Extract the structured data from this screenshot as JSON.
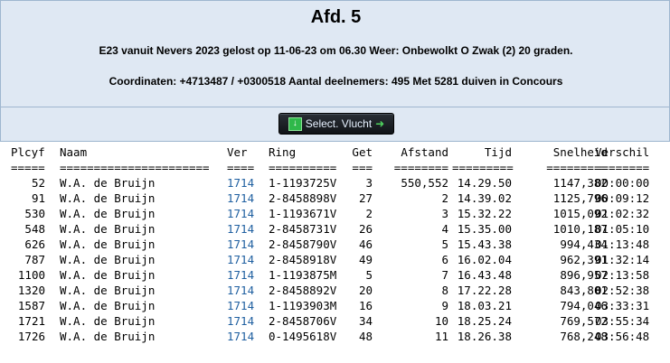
{
  "header": {
    "title": "Afd. 5",
    "line1": "E23 vanuit Nevers 2023 gelost op 11-06-23 om 06.30 Weer: Onbewolkt O Zwak (2) 20 graden.",
    "line2": "Coordinaten: +4713487 / +0300518 Aantal deelnemers: 495 Met 5281 duiven in Concours"
  },
  "toolbar": {
    "select_label": "Select. Vlucht"
  },
  "table": {
    "columns": {
      "plcyf": "Plcyf",
      "naam": "Naam",
      "ver": "Ver",
      "ring": "Ring",
      "get": "Get",
      "afstand": "Afstand",
      "tijd": "Tijd",
      "snelheid": "Snelheid",
      "verschil": "Verschil"
    },
    "separators": {
      "plcyf": "=====",
      "naam": "======================",
      "ver": "====",
      "ring": "==========",
      "get": "===",
      "afstand": "========",
      "tijd": "=========",
      "snelheid": "=========",
      "verschil": "========"
    },
    "rows": [
      {
        "plcyf": "52",
        "naam": "W.A. de Bruijn",
        "ver": "1714",
        "ring": "1-1193725V",
        "get": "3",
        "afstand": "550,552",
        "tijd": "14.29.50",
        "snelheid": "1147,382",
        "verschil": "00:00:00"
      },
      {
        "plcyf": "91",
        "naam": "W.A. de Bruijn",
        "ver": "1714",
        "ring": "2-8458898V",
        "get": "27",
        "afstand": "2",
        "tijd": "14.39.02",
        "snelheid": "1125,796",
        "verschil": "00:09:12"
      },
      {
        "plcyf": "530",
        "naam": "W.A. de Bruijn",
        "ver": "1714",
        "ring": "1-1193671V",
        "get": "2",
        "afstand": "3",
        "tijd": "15.32.22",
        "snelheid": "1015,092",
        "verschil": "01:02:32"
      },
      {
        "plcyf": "548",
        "naam": "W.A. de Bruijn",
        "ver": "1714",
        "ring": "2-8458731V",
        "get": "26",
        "afstand": "4",
        "tijd": "15.35.00",
        "snelheid": "1010,187",
        "verschil": "01:05:10"
      },
      {
        "plcyf": "626",
        "naam": "W.A. de Bruijn",
        "ver": "1714",
        "ring": "2-8458790V",
        "get": "46",
        "afstand": "5",
        "tijd": "15.43.38",
        "snelheid": "994,434",
        "verschil": "01:13:48"
      },
      {
        "plcyf": "787",
        "naam": "W.A. de Bruijn",
        "ver": "1714",
        "ring": "2-8458918V",
        "get": "49",
        "afstand": "6",
        "tijd": "16.02.04",
        "snelheid": "962,391",
        "verschil": "01:32:14"
      },
      {
        "plcyf": "1100",
        "naam": "W.A. de Bruijn",
        "ver": "1714",
        "ring": "1-1193875M",
        "get": "5",
        "afstand": "7",
        "tijd": "16.43.48",
        "snelheid": "896,957",
        "verschil": "02:13:58"
      },
      {
        "plcyf": "1320",
        "naam": "W.A. de Bruijn",
        "ver": "1714",
        "ring": "2-8458892V",
        "get": "20",
        "afstand": "8",
        "tijd": "17.22.28",
        "snelheid": "843,801",
        "verschil": "02:52:38"
      },
      {
        "plcyf": "1587",
        "naam": "W.A. de Bruijn",
        "ver": "1714",
        "ring": "1-1193903M",
        "get": "16",
        "afstand": "9",
        "tijd": "18.03.21",
        "snelheid": "794,046",
        "verschil": "03:33:31"
      },
      {
        "plcyf": "1721",
        "naam": "W.A. de Bruijn",
        "ver": "1714",
        "ring": "2-8458706V",
        "get": "34",
        "afstand": "10",
        "tijd": "18.25.24",
        "snelheid": "769,572",
        "verschil": "03:55:34"
      },
      {
        "plcyf": "1726",
        "naam": "W.A. de Bruijn",
        "ver": "1714",
        "ring": "0-1495618V",
        "get": "48",
        "afstand": "11",
        "tijd": "18.26.38",
        "snelheid": "768,248",
        "verschil": "03:56:48"
      }
    ]
  },
  "icons": {
    "select_left": "download-icon",
    "select_right": "arrow-right-icon"
  },
  "colors": {
    "header_bg": "#dfe8f3",
    "link": "#1f5fa0",
    "button_bg": "#1a1e23"
  }
}
